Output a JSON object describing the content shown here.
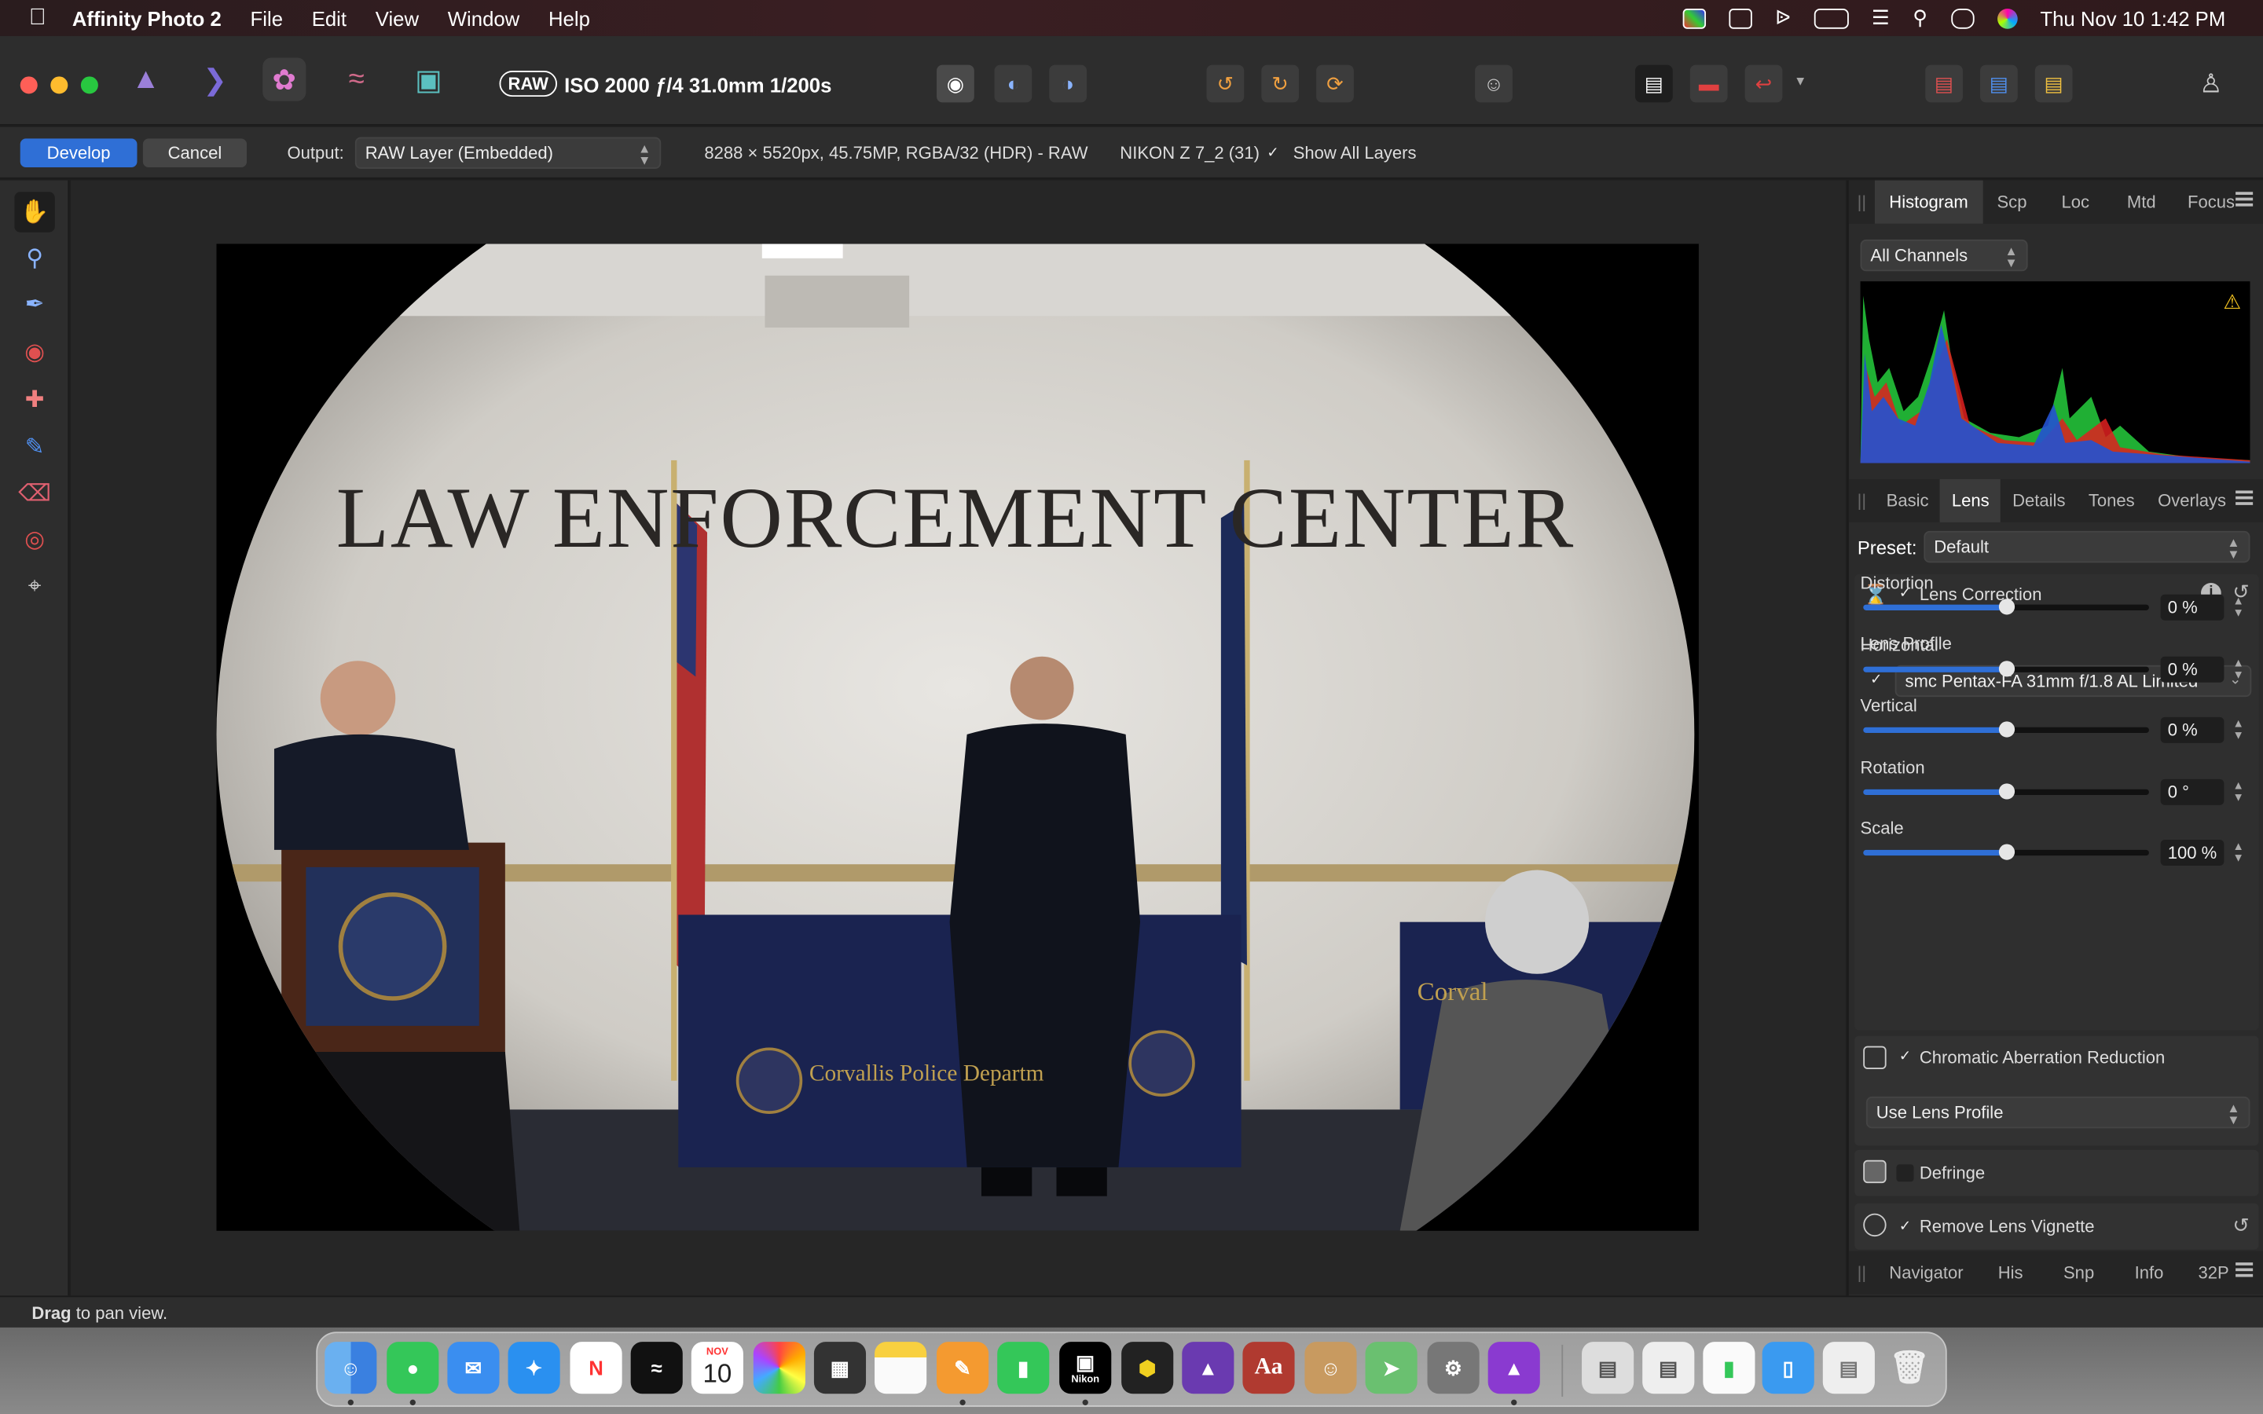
{
  "menubar": {
    "app_name": "Affinity Photo 2",
    "items": [
      "File",
      "Edit",
      "View",
      "Window",
      "Help"
    ],
    "datetime": "Thu Nov 10  1:42 PM"
  },
  "toolbar": {
    "raw_badge": "RAW",
    "exposure_info": "ISO 2000 ƒ/4 31.0mm 1/200s"
  },
  "context": {
    "develop_label": "Develop",
    "cancel_label": "Cancel",
    "output_label": "Output:",
    "output_value": "RAW Layer (Embedded)",
    "image_info": "8288 × 5520px, 45.75MP, RGBA/32 (HDR) - RAW",
    "camera": "NIKON Z 7_2 (31)",
    "show_all_layers": "Show All Layers",
    "show_all_layers_checked": true
  },
  "photo": {
    "wall_sign": "LAW ENFORCEMENT CENTER",
    "table_text": "Corvallis Police Departm",
    "table_text_right": "Corval"
  },
  "top_panel": {
    "tabs": [
      "Histogram",
      "Scp",
      "Loc",
      "Mtd",
      "Focus"
    ],
    "active_tab": "Histogram",
    "channels": "All Channels"
  },
  "develop_panel": {
    "tabs": [
      "Basic",
      "Lens",
      "Details",
      "Tones",
      "Overlays"
    ],
    "active_tab": "Lens",
    "preset_label": "Preset:",
    "preset_value": "Default",
    "lens_correction": {
      "title": "Lens Correction",
      "profile_label": "Lens Profile",
      "profile_value": "smc Pentax-FA 31mm f/1.8 AL Limited",
      "sliders": [
        {
          "label": "Distortion",
          "value": "0 %",
          "position": 0.5
        },
        {
          "label": "Horizontal",
          "value": "0 %",
          "position": 0.5
        },
        {
          "label": "Vertical",
          "value": "0 %",
          "position": 0.5
        },
        {
          "label": "Rotation",
          "value": "0 °",
          "position": 0.5
        },
        {
          "label": "Scale",
          "value": "100 %",
          "position": 0.5
        }
      ]
    },
    "chromatic": {
      "title": "Chromatic Aberration Reduction",
      "mode": "Use Lens Profile"
    },
    "defringe": {
      "title": "Defringe"
    },
    "vignette": {
      "title": "Remove Lens Vignette"
    }
  },
  "bottom_panel": {
    "tabs": [
      "Navigator",
      "His",
      "Snp",
      "Info",
      "32P"
    ]
  },
  "status": {
    "bold": "Drag",
    "rest": " to pan view."
  },
  "dock": {
    "calendar_month": "NOV",
    "calendar_day": "10",
    "nikon_label": "Nikon",
    "dictionary_label": "Aa"
  },
  "colors": {
    "accent": "#2f6fd6",
    "develop_button": "#2f6fd6",
    "panel_bg": "#2b2b2b"
  }
}
